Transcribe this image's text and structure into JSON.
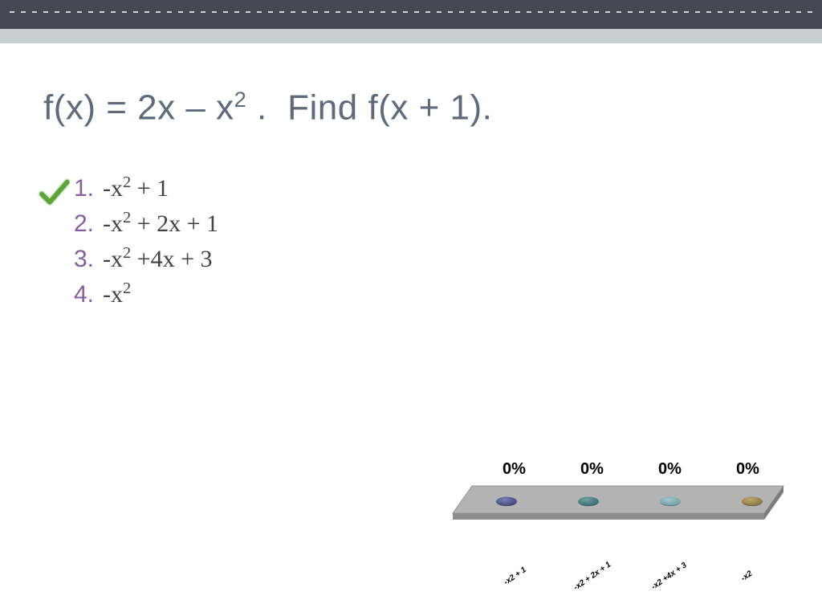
{
  "title": {
    "html": "f(x) = 2x – x<span class='sup'>2</span> .&nbsp;&nbsp;Find f(x + 1)."
  },
  "answers": [
    {
      "num": "1.",
      "html": "-x<span class='ss'>2</span> + 1",
      "correct": true
    },
    {
      "num": "2.",
      "html": "-x<span class='ss'>2</span> + 2x + 1",
      "correct": false
    },
    {
      "num": "3.",
      "html": "-x<span class='ss'>2</span> +4x + 3",
      "correct": false
    },
    {
      "num": "4.",
      "html": "-x<span class='ss'>2</span>",
      "correct": false
    }
  ],
  "chart_data": {
    "type": "bar",
    "categories": [
      "-x2 + 1",
      "-x2 + 2x + 1",
      "-x2 +4x + 3",
      "-x2"
    ],
    "values": [
      0,
      0,
      0,
      0
    ],
    "value_labels": [
      "0%",
      "0%",
      "0%",
      "0%"
    ],
    "ylim": [
      0,
      100
    ]
  },
  "colors": {
    "title": "#5f6a7a",
    "list_number": "#865e9c",
    "answer_text": "#424242",
    "topbar": "#454953",
    "subbar": "#c7cfd0",
    "disc": [
      "#4a4e84",
      "#3d7576",
      "#78a4aa",
      "#8e7c46"
    ],
    "check": "#4caf50"
  }
}
